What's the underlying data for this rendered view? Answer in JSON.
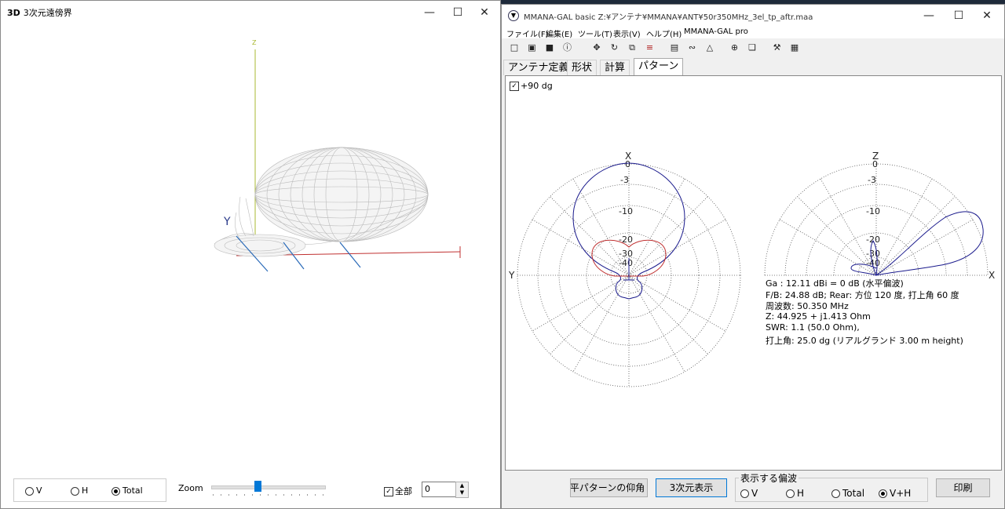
{
  "win3d": {
    "title": "3次元遠傍界",
    "title_icon": "3D",
    "axis_z": "Z",
    "axis_y": "Y",
    "pol_v": "V",
    "pol_h": "H",
    "pol_total": "Total",
    "selected_pol": "Total",
    "zoom_label": "Zoom",
    "zoom_value_pct": 40,
    "all_label": "全部",
    "all_checked": true,
    "spin_value": "0"
  },
  "main": {
    "title": "MMANA-GAL basic Z:¥アンテナ¥MMANA¥ANT¥50r350MHz_3el_tp_aftr.maa",
    "menu": [
      "ファイル(F)",
      "編集(E)",
      "ツール(T)",
      "表示(V)",
      "ヘルプ(H)",
      "MMANA-GAL pro"
    ],
    "tools": [
      "new-file-icon",
      "open-folder-icon",
      "save-icon",
      "info-icon",
      "move-icon",
      "rotate-icon",
      "copy-icon",
      "list-icon",
      "document-icon",
      "graph-icon",
      "triangle-icon",
      "crosshair-icon",
      "window-icon",
      "tools-icon",
      "calculator-icon"
    ],
    "tabs": [
      "アンテナ定義",
      "形状",
      "計算",
      "パターン"
    ],
    "active_tab": "パターン",
    "checkbox_90": "+90 dg",
    "horiz_plot": {
      "top": "X",
      "left": "Y",
      "rings": [
        "0",
        "-3",
        "-10",
        "-20",
        "-30",
        "-40"
      ]
    },
    "vert_plot": {
      "top": "Z",
      "right": "X",
      "rings": [
        "0",
        "-3",
        "-10",
        "-20",
        "-30",
        "-40"
      ]
    },
    "info": [
      "Ga : 12.11 dBi = 0 dB  (水平偏波)",
      "F/B: 24.88 dB; Rear: 方位 120 度,  打上角 60 度",
      "周波数: 50.350 MHz",
      "Z: 44.925 + j1.413 Ohm",
      "SWR: 1.1 (50.0 Ohm),",
      "打上角: 25.0 dg (リアルグランド   3.00 m height)"
    ],
    "btn_elev": "水平パターンの仰角",
    "btn_3d": "3次元表示",
    "pol_group": "表示する偏波",
    "pol_v": "V",
    "pol_h": "H",
    "pol_total": "Total",
    "pol_vh": "V+H",
    "selected_pol": "V+H",
    "btn_print": "印刷",
    "colors": {
      "pattern_main": "#1a1a8c",
      "pattern_secondary": "#c03030",
      "grid": "#555555"
    }
  }
}
